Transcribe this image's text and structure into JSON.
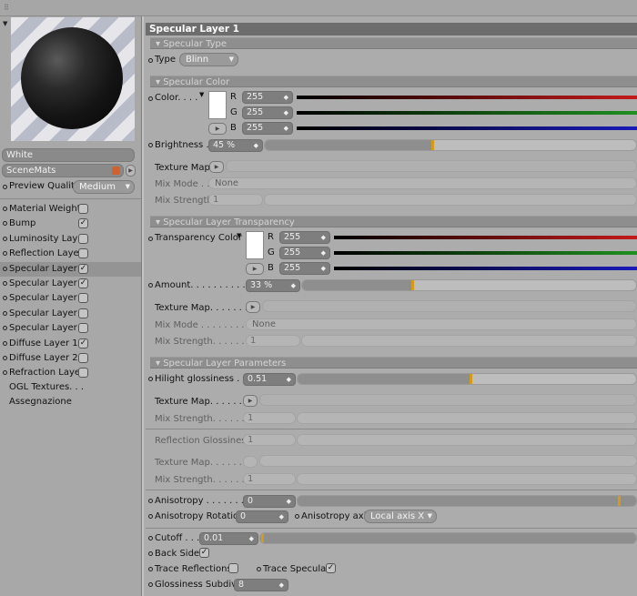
{
  "left": {
    "material_name": "White",
    "scene_mats": "SceneMats",
    "preview_quality_label": "Preview Quality",
    "preview_quality_value": "Medium",
    "channels": [
      {
        "label": "Material Weight",
        "checked": false
      },
      {
        "label": "Bump",
        "checked": true
      },
      {
        "label": "Luminosity Layer",
        "checked": false
      },
      {
        "label": "Reflection Layer",
        "checked": false
      },
      {
        "label": "Specular Layer 1",
        "checked": true
      },
      {
        "label": "Specular Layer 2",
        "checked": true
      },
      {
        "label": "Specular Layer 3",
        "checked": false
      },
      {
        "label": "Specular Layer 4",
        "checked": false
      },
      {
        "label": "Specular Layer 5",
        "checked": false
      },
      {
        "label": "Diffuse Layer 1",
        "checked": true
      },
      {
        "label": "Diffuse Layer 2",
        "checked": false
      },
      {
        "label": "Refraction Layer",
        "checked": false
      }
    ],
    "ogl_textures": "OGL Textures. . .",
    "assegnazione": "Assegnazione"
  },
  "right": {
    "title": "Specular Layer 1",
    "sec_type": "Specular Type",
    "type_label": "Type",
    "type_value": "Blinn",
    "sec_color": "Specular Color",
    "color_label": "Color. . . .",
    "color_r": "255",
    "color_g": "255",
    "color_b": "255",
    "brightness_label": "Brightness .",
    "brightness_value": "45 %",
    "brightness_pct": 45,
    "texture_map_label": "Texture Map",
    "mix_mode_label": "Mix Mode . .",
    "mix_mode_value": "None",
    "mix_strength_label": "Mix Strength",
    "mix_strength_value": "1",
    "sec_transparency": "Specular Layer Transparency",
    "transparency_color_label": "Transparency Color",
    "t_r": "255",
    "t_g": "255",
    "t_b": "255",
    "amount_label": "Amount. . . . . . . . . . . . .",
    "amount_value": "33 %",
    "amount_pct": 33,
    "t_texture_map_label": "Texture Map. . . . . . . .",
    "t_mix_mode_label": "Mix Mode . . . . . . . . . .",
    "t_mix_mode_value": "None",
    "t_mix_strength_label": "Mix Strength. . . . . . . .",
    "t_mix_strength_value": "1",
    "sec_params": "Specular Layer Parameters",
    "hilight_label": "Hilight glossiness . . .",
    "hilight_value": "0.51",
    "hilight_frac": 0.51,
    "p_texture_map_label": "Texture Map. . . . . . . .",
    "p_mix_strength_label": "Mix Strength. . . . . . .",
    "p_mix_strength_value": "1",
    "refl_gloss_label": "Reflection Glossiness",
    "refl_gloss_value": "1",
    "r_texture_map_label": "Texture Map. . . . . . .",
    "r_mix_strength_label": "Mix Strength. . . . . . .",
    "r_mix_strength_value": "1",
    "anisotropy_label": "Anisotropy . . . . . . . . .",
    "anisotropy_value": "0",
    "aniso_rotation_label": "Anisotropy Rotation",
    "aniso_rotation_value": "0",
    "aniso_axis_label": "Anisotropy axis",
    "aniso_axis_value": "Local axis X",
    "cutoff_label": "Cutoff . . .",
    "cutoff_value": "0.01",
    "backside_label": "Back Side",
    "trace_refl_label": "Trace Reflections",
    "trace_spec_label": "Trace Specular",
    "gloss_subdivs_label": "Glossiness Subdivs",
    "gloss_subdivs_value": "8",
    "rgb_letters": [
      "R",
      "G",
      "B"
    ]
  },
  "colors": {
    "marker": "#d49a1a",
    "red": "#c41a1a",
    "green": "#1f8f1f",
    "blue": "#1a1ab8"
  }
}
